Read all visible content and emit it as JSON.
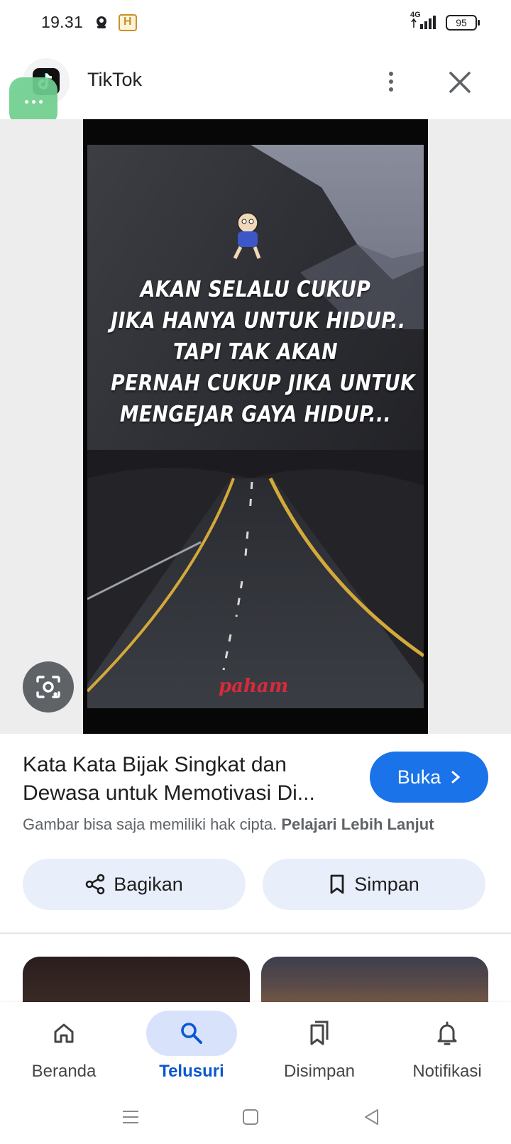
{
  "status_bar": {
    "time": "19.31",
    "network": "4G",
    "battery": "95"
  },
  "header": {
    "source_name": "TikTok",
    "logo_icon": "tiktok-logo",
    "more_icon": "more-vert-icon",
    "close_icon": "close-icon"
  },
  "image": {
    "quote_lines": [
      "AKAN SELALU CUKUP",
      "JIKA HANYA UNTUK HIDUP..",
      "TAPI TAK AKAN",
      "PERNAH CUKUP JIKA UNTUK",
      "MENGEJAR GAYA HIDUP..."
    ],
    "watermark": "paham",
    "lens_icon": "lens-icon"
  },
  "result": {
    "title_line1": "Kata Kata Bijak Singkat dan",
    "title_line2": "Dewasa untuk Memotivasi Di...",
    "open_label": "Buka",
    "copyright_text": "Gambar bisa saja memiliki hak cipta.",
    "learn_more": "Pelajari Lebih Lanjut",
    "share_label": "Bagikan",
    "save_label": "Simpan"
  },
  "bottom_nav": {
    "items": [
      {
        "label": "Beranda",
        "icon": "home-icon",
        "active": false
      },
      {
        "label": "Telusuri",
        "icon": "search-icon",
        "active": true
      },
      {
        "label": "Disimpan",
        "icon": "collections-icon",
        "active": false
      },
      {
        "label": "Notifikasi",
        "icon": "bell-icon",
        "active": false
      }
    ]
  },
  "colors": {
    "accent": "#1a73e8",
    "active_nav": "#0b57d0",
    "active_pill": "#d8e3fb",
    "chip_bg": "#e8eefa",
    "watermark": "#d82a3a"
  }
}
